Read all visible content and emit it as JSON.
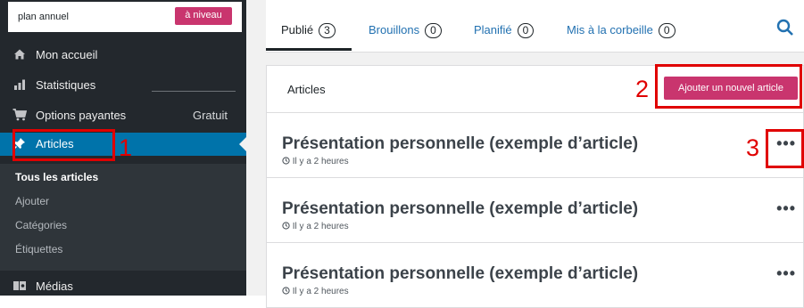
{
  "sidebar": {
    "plan_label": "plan annuel",
    "upgrade_label": "à niveau",
    "items": [
      {
        "label": "Mon accueil",
        "icon": "home-icon"
      },
      {
        "label": "Statistiques",
        "icon": "bar-chart-icon"
      },
      {
        "label": "Options payantes",
        "icon": "cart-icon",
        "badge": "Gratuit"
      },
      {
        "label": "Articles",
        "icon": "pushpin-icon"
      }
    ],
    "submenu": [
      "Tous les articles",
      "Ajouter",
      "Catégories",
      "Étiquettes"
    ],
    "medias_label": "Médias"
  },
  "tabs": [
    {
      "label": "Publié",
      "count": "3"
    },
    {
      "label": "Brouillons",
      "count": "0"
    },
    {
      "label": "Planifié",
      "count": "0"
    },
    {
      "label": "Mis à la corbeille",
      "count": "0"
    }
  ],
  "header": {
    "title": "Articles",
    "add_button": "Ajouter un nouvel article"
  },
  "posts": [
    {
      "title": "Présentation personnelle (exemple d’article)",
      "meta": "Il y a 2 heures"
    },
    {
      "title": "Présentation personnelle (exemple d’article)",
      "meta": "Il y a 2 heures"
    },
    {
      "title": "Présentation personnelle (exemple d’article)",
      "meta": "Il y a 2 heures"
    }
  ],
  "annotations": [
    "1",
    "2",
    "3"
  ],
  "colors": {
    "sidebar_bg": "#23282d",
    "active_blue": "#0073aa",
    "accent_pink": "#c9356e",
    "annotation_red": "#e00000"
  }
}
